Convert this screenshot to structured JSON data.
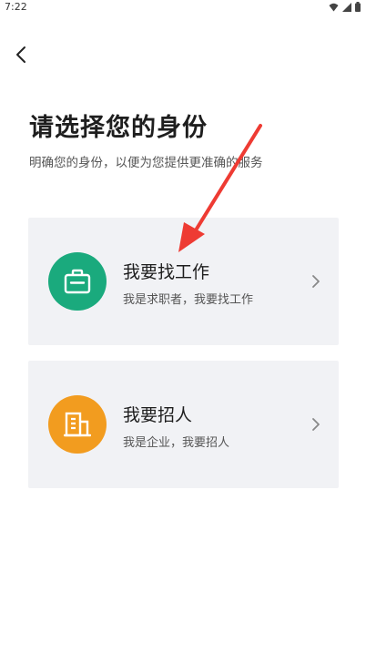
{
  "status_bar": {
    "time": "7:22",
    "icons": [
      "wifi-icon",
      "signal-icon",
      "battery-icon"
    ]
  },
  "header": {
    "back_icon": "chevron-left-icon"
  },
  "page": {
    "title": "请选择您的身份",
    "subtitle": "明确您的身份，以便为您提供更准确的服务"
  },
  "options": [
    {
      "title": "我要找工作",
      "description": "我是求职者，我要找工作",
      "icon": "briefcase-icon",
      "icon_color": "#1aaa7d"
    },
    {
      "title": "我要招人",
      "description": "我是企业，我要招人",
      "icon": "building-icon",
      "icon_color": "#f29c1f"
    }
  ],
  "annotation": {
    "arrow_color": "#ee3b33"
  }
}
